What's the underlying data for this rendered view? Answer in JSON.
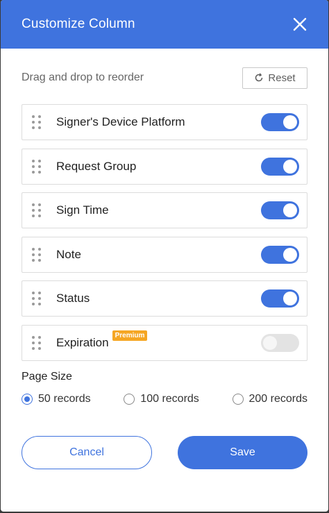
{
  "header": {
    "title": "Customize Column",
    "close_icon": "close-icon"
  },
  "subheader": {
    "hint": "Drag and drop to reorder",
    "reset_label": "Reset",
    "reset_icon": "refresh-icon"
  },
  "columns": [
    {
      "label": "Signer's Device Platform",
      "enabled": true
    },
    {
      "label": "Request Group",
      "enabled": true
    },
    {
      "label": "Sign Time",
      "enabled": true
    },
    {
      "label": "Note",
      "enabled": true
    },
    {
      "label": "Status",
      "enabled": true
    },
    {
      "label": "Expiration",
      "enabled": false,
      "badge": "Premium"
    }
  ],
  "page_size": {
    "title": "Page Size",
    "options": [
      "50 records",
      "100 records",
      "200 records"
    ],
    "selected": "50 records"
  },
  "footer": {
    "cancel_label": "Cancel",
    "save_label": "Save"
  },
  "colors": {
    "accent": "#3f73de",
    "badge": "#f5a623",
    "toggle_off": "#e3e3e3"
  }
}
